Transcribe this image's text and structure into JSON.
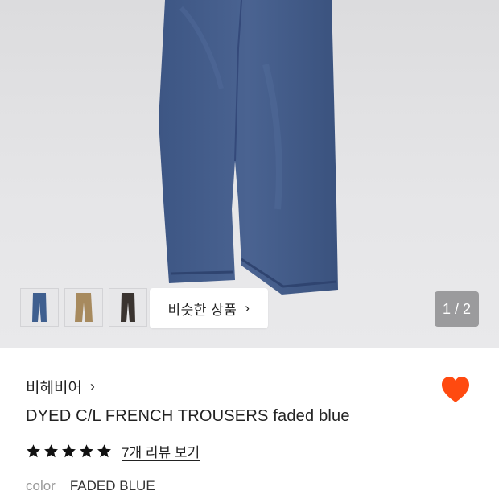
{
  "gallery": {
    "similar_button_label": "비슷한 상품",
    "counter": "1 / 2",
    "thumbnails": [
      {
        "name": "thumb-blue",
        "color": "#3f5f8f"
      },
      {
        "name": "thumb-khaki",
        "color": "#a78a5e"
      },
      {
        "name": "thumb-dark",
        "color": "#3a3430"
      }
    ]
  },
  "product": {
    "brand": "비헤비어",
    "title": "DYED C/L FRENCH TROUSERS faded blue",
    "rating": 5,
    "reviews_label": "7개 리뷰 보기",
    "color_label": "color",
    "color_value": "FADED BLUE",
    "favorited": true
  },
  "colors": {
    "heart": "#ff4a10",
    "star": "#111111",
    "counter_bg": "#9b9b9d",
    "pants": "#425b87"
  },
  "icons": {
    "chevron": "chevron-right-icon",
    "heart": "heart-icon",
    "star": "star-icon"
  }
}
